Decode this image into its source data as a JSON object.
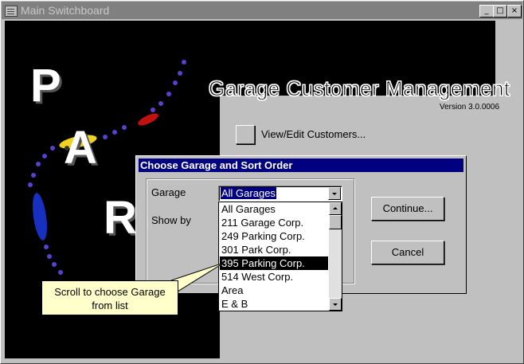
{
  "window": {
    "title": "Main Switchboard",
    "sys_icon": "form-icon",
    "controls": {
      "minimize": "_",
      "maximize": "□",
      "close": "×"
    }
  },
  "splash": {
    "letters": [
      "P",
      "A",
      "R"
    ],
    "app_title": "Garage Customer Management",
    "version": "Version 3.0.0006"
  },
  "switchboard": {
    "view_edit_label": "View/Edit Customers..."
  },
  "dialog": {
    "title": "Choose Garage and Sort Order",
    "garage_label": "Garage",
    "show_by_label": "Show by",
    "garage_value": "All Garages",
    "garage_options": [
      "All Garages",
      "211 Garage Corp.",
      "249 Parking Corp.",
      "301 Park Corp.",
      "395 Parking Corp.",
      "514 West Corp.",
      "Area",
      "E & B"
    ],
    "selected_index": 4,
    "continue_label": "Continue...",
    "cancel_label": "Cancel"
  },
  "callout": {
    "line1": "Scroll to choose Garage",
    "line2": "from list"
  },
  "colors": {
    "titlebar_inactive": "#808080",
    "dialog_title": "#000080",
    "callout_bg": "#ffffcc",
    "face": "#c0c0c0"
  }
}
